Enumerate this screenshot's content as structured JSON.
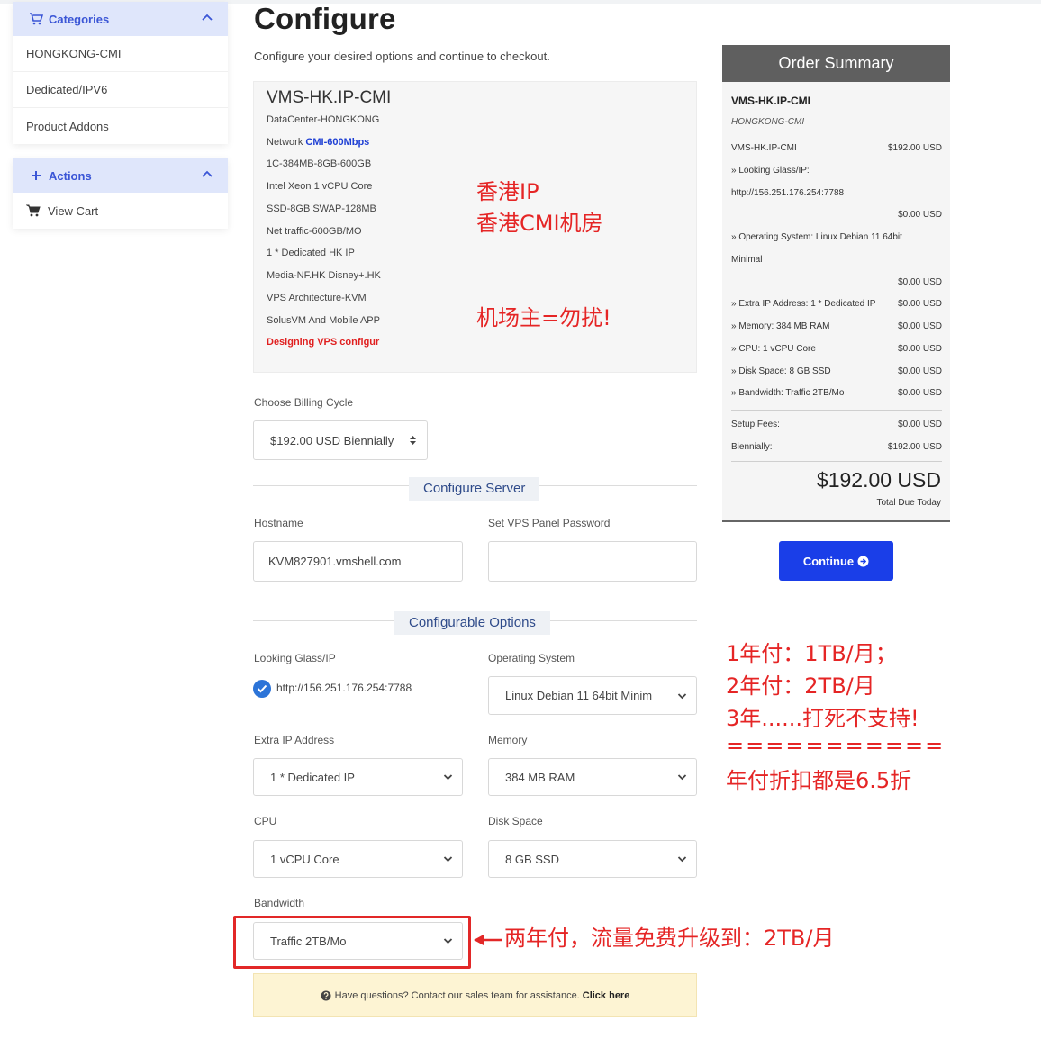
{
  "sidebar": {
    "categories": {
      "title": "Categories",
      "items": [
        "HONGKONG-CMI",
        "Dedicated/IPV6",
        "Product Addons"
      ]
    },
    "actions": {
      "title": "Actions",
      "items": [
        "View Cart"
      ]
    }
  },
  "header": {
    "title": "Configure",
    "subtitle": "Configure your desired options and continue to checkout."
  },
  "product": {
    "name": "VMS-HK.IP-CMI",
    "specs": {
      "datacenter": "DataCenter-HONGKONG",
      "network_label": "Network",
      "network_value": "CMI-600Mbps",
      "plan": "1C-384MB-8GB-600GB",
      "cpu": "Intel Xeon 1 vCPU Core",
      "ssd": "SSD-8GB SWAP-128MB",
      "traffic": "Net traffic-600GB/MO",
      "ip": "1 * Dedicated HK IP",
      "media": "Media-NF.HK Disney+.HK",
      "arch": "VPS Architecture-KVM",
      "panel": "SolusVM And Mobile APP",
      "designing": "Designing VPS configur"
    }
  },
  "annotations": {
    "hk_ip": "香港IP",
    "hk_cmi": "香港CMI机房",
    "warning": "机场主=勿扰!",
    "pay1": "1年付：1TB/月；",
    "pay2": "2年付：2TB/月",
    "pay3": "3年......打死不支持!",
    "equals": "===========",
    "discount": "年付折扣都是6.5折",
    "upgrade": "两年付，流量免费升级到：2TB/月"
  },
  "billing": {
    "label": "Choose Billing Cycle",
    "value": "$192.00 USD Biennially"
  },
  "configure_server": {
    "title": "Configure Server",
    "hostname_label": "Hostname",
    "hostname_value": "KVM827901.vmshell.com",
    "password_label": "Set VPS Panel Password",
    "password_value": ""
  },
  "options": {
    "title": "Configurable Options",
    "looking_glass_label": "Looking Glass/IP",
    "looking_glass_value": "http://156.251.176.254:7788",
    "os_label": "Operating System",
    "os_value": "Linux Debian 11 64bit Minim",
    "extra_ip_label": "Extra IP Address",
    "extra_ip_value": "1 * Dedicated IP",
    "memory_label": "Memory",
    "memory_value": "384 MB RAM",
    "cpu_label": "CPU",
    "cpu_value": "1 vCPU Core",
    "disk_label": "Disk Space",
    "disk_value": "8 GB SSD",
    "bandwidth_label": "Bandwidth",
    "bandwidth_value": "Traffic 2TB/Mo"
  },
  "help": {
    "text": "Have questions? Contact our sales team for assistance.",
    "link": "Click here"
  },
  "summary": {
    "title": "Order Summary",
    "product": "VMS-HK.IP-CMI",
    "group": "HONGKONG-CMI",
    "rows": [
      {
        "label": "VMS-HK.IP-CMI",
        "amount": "$192.00 USD"
      },
      {
        "label": "» Looking Glass/IP:",
        "amount": ""
      },
      {
        "label": "http://156.251.176.254:7788",
        "amount": ""
      },
      {
        "label": "",
        "amount": "$0.00 USD"
      },
      {
        "label": "» Operating System: Linux Debian 11 64bit",
        "amount": ""
      },
      {
        "label": "Minimal",
        "amount": ""
      },
      {
        "label": "",
        "amount": "$0.00 USD"
      },
      {
        "label": "» Extra IP Address: 1 * Dedicated IP",
        "amount": "$0.00 USD"
      },
      {
        "label": "» Memory: 384 MB RAM",
        "amount": "$0.00 USD"
      },
      {
        "label": "» CPU: 1 vCPU Core",
        "amount": "$0.00 USD"
      },
      {
        "label": "» Disk Space: 8 GB SSD",
        "amount": "$0.00 USD"
      },
      {
        "label": "» Bandwidth: Traffic 2TB/Mo",
        "amount": "$0.00 USD"
      }
    ],
    "setup_label": "Setup Fees:",
    "setup_amount": "$0.00 USD",
    "cycle_label": "Biennially:",
    "cycle_amount": "$192.00 USD",
    "total": "$192.00 USD",
    "total_label": "Total Due Today"
  },
  "continue_label": "Continue",
  "colors": {
    "accent": "#1a3ee8",
    "annotation_red": "#e52525",
    "sidebar_header": "#dfe6fb"
  },
  "icons": [
    "cart-icon",
    "plus-icon",
    "chevron-up-icon",
    "chevron-down-icon",
    "check-circle-icon",
    "question-icon",
    "arrow-right-circle-icon",
    "red-arrow-icon"
  ]
}
